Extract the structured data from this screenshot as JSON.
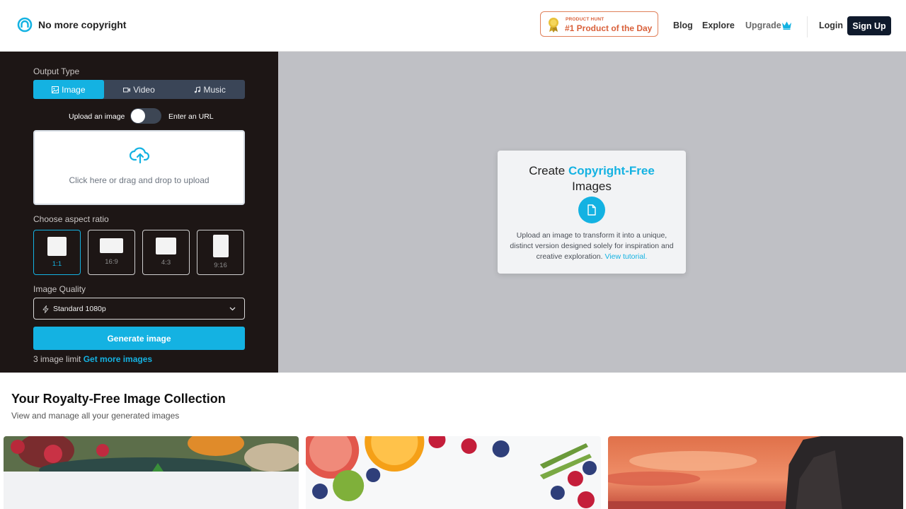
{
  "header": {
    "logo_text": "No more copyright",
    "badge_small": "PRODUCT HUNT",
    "badge_big": "#1 Product of the Day",
    "nav": {
      "blog": "Blog",
      "explore": "Explore",
      "upgrade": "Upgrade"
    },
    "login": "Login",
    "signup": "Sign Up"
  },
  "panel": {
    "output_type_label": "Output Type",
    "tabs": [
      {
        "label": "Image",
        "active": true
      },
      {
        "label": "Video",
        "active": false
      },
      {
        "label": "Music",
        "active": false
      }
    ],
    "toggle_left": "Upload an image",
    "toggle_right": "Enter an URL",
    "upload_text": "Click here or drag and drop to upload",
    "aspect_label": "Choose aspect ratio",
    "ratios": [
      "1:1",
      "16:9",
      "4:3",
      "9:16"
    ],
    "quality_label": "Image Quality",
    "quality_value": "Standard 1080p",
    "generate": "Generate image",
    "limit_text": "3 image limit",
    "limit_link": "Get more images"
  },
  "card": {
    "title_pre": "Create",
    "title_highlight": "Copyright-Free",
    "title_post": "Images",
    "desc": "Upload an image to transform it into a unique, distinct version designed solely for inspiration and creative exploration.",
    "tutorial_link": "View tutorial."
  },
  "collection": {
    "title": "Your Royalty-Free Image Collection",
    "subtitle": "View and manage all your generated images"
  },
  "colors": {
    "accent": "#14b2e2",
    "panel_bg": "#1d1615",
    "preview_bg": "#bfc0c5",
    "signup_bg": "#0f1a2c",
    "badge": "#d9603a"
  }
}
